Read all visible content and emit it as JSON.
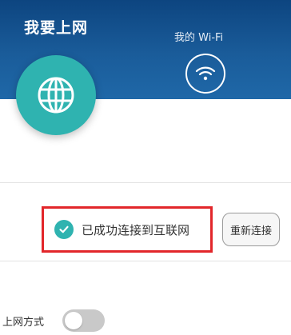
{
  "header": {
    "tabs": [
      {
        "label": "我要上网",
        "icon": "globe-icon",
        "active": true
      },
      {
        "label": "我的 Wi-Fi",
        "icon": "wifi-icon",
        "active": false
      }
    ]
  },
  "status": {
    "icon": "checkmark-icon",
    "text": "已成功连接到互联网",
    "reconnect_label": "重新连接"
  },
  "settings": {
    "mode_label": "上网方式",
    "mode_toggle_on": false
  },
  "colors": {
    "header_bg": "#1a5c9a",
    "accent_teal": "#2fb3b0",
    "highlight_red": "#e2262a"
  }
}
